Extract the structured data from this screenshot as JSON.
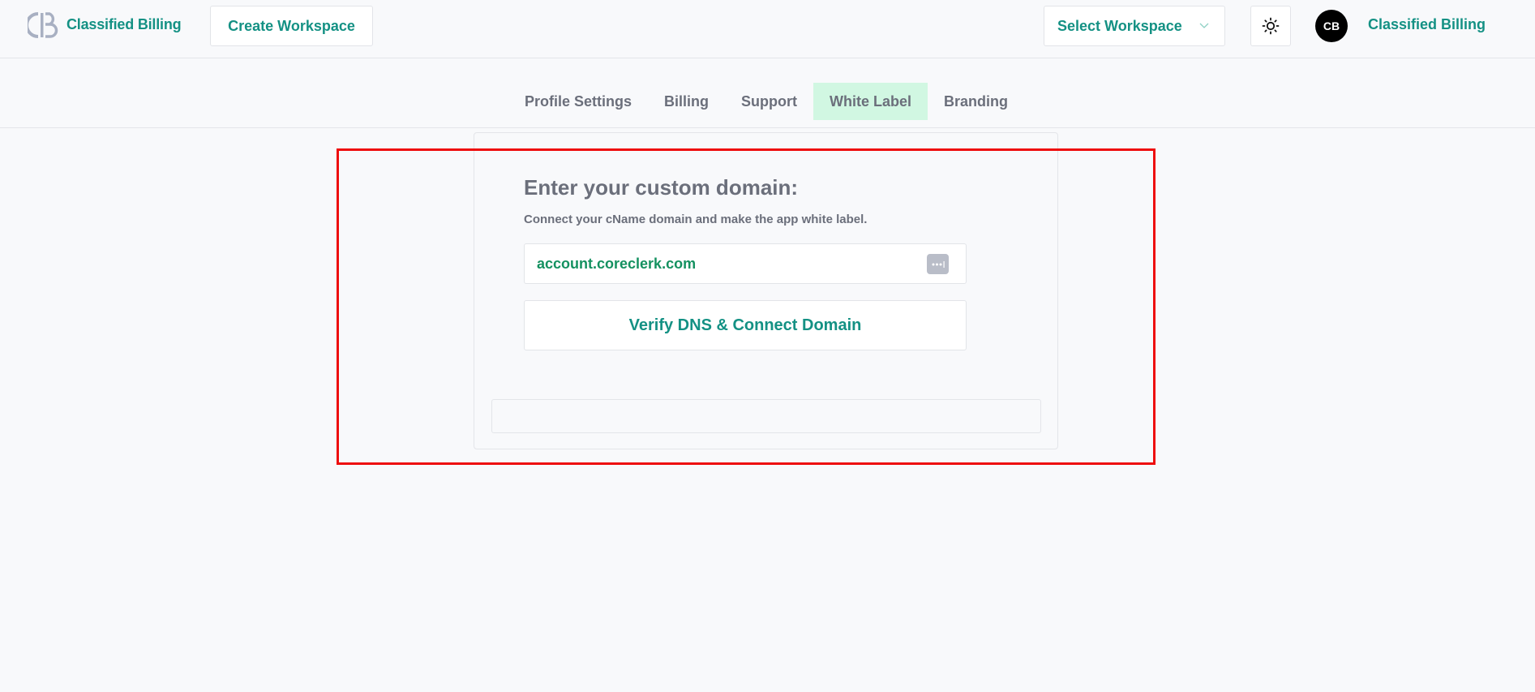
{
  "header": {
    "brand_name": "Classified Billing",
    "logo_icon": "cb-logo-icon",
    "create_workspace_label": "Create Workspace",
    "select_workspace_label": "Select Workspace",
    "theme_toggle_icon": "sun-icon",
    "avatar_initials": "CB",
    "user_name": "Classified Billing"
  },
  "tabs": [
    {
      "label": "Profile Settings",
      "active": false
    },
    {
      "label": "Billing",
      "active": false
    },
    {
      "label": "Support",
      "active": false
    },
    {
      "label": "White Label",
      "active": true
    },
    {
      "label": "Branding",
      "active": false
    }
  ],
  "white_label": {
    "title": "Enter your custom domain:",
    "subtitle": "Connect your cName domain and make the app white label.",
    "domain_value": "account.coreclerk.com",
    "input_icon": "password-manager-icon",
    "verify_button_label": "Verify DNS & Connect Domain",
    "result_text": ""
  },
  "colors": {
    "accent": "#149184",
    "active_tab_bg": "#d1f7e2",
    "muted_text": "#6b6f7b",
    "highlight_border": "#ee0d0d"
  }
}
